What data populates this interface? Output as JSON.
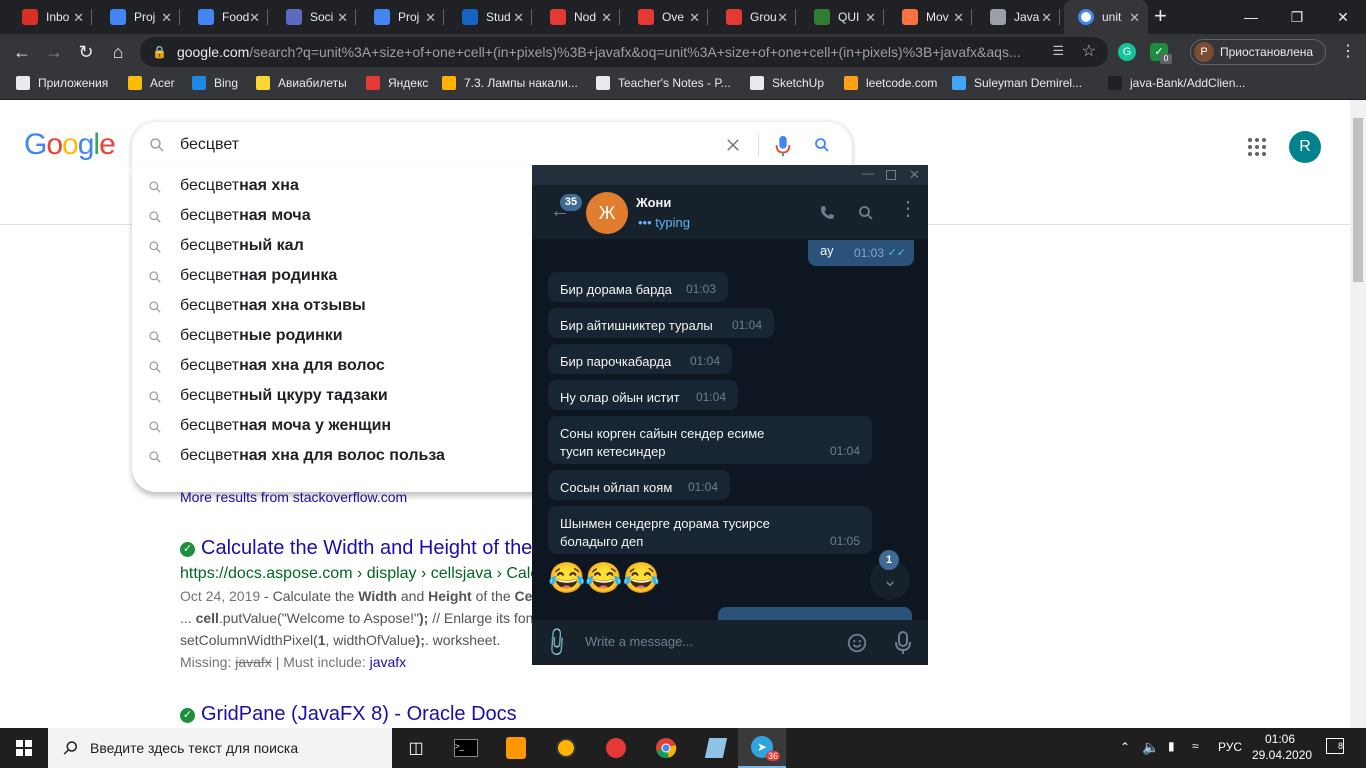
{
  "browser": {
    "tabs": [
      {
        "label": "Inbo",
        "color": "#d93025"
      },
      {
        "label": "Proj",
        "color": "#4285f4"
      },
      {
        "label": "Food",
        "color": "#4285f4"
      },
      {
        "label": "Soci",
        "color": "#5c6bc0"
      },
      {
        "label": "Proj",
        "color": "#4285f4"
      },
      {
        "label": "Stud",
        "color": "#1565c0"
      },
      {
        "label": "Nod",
        "color": "#e53935"
      },
      {
        "label": "Ove",
        "color": "#e53935"
      },
      {
        "label": "Grou",
        "color": "#e53935"
      },
      {
        "label": "QUI",
        "color": "#2e7d32"
      },
      {
        "label": "Mov",
        "color": "#ff7043"
      },
      {
        "label": "Java",
        "color": "#9aa0a6"
      },
      {
        "label": "unit",
        "color": "#ffffff"
      }
    ],
    "url_host": "google.com",
    "url_path": "/search?q=unit%3A+size+of+one+cell+(in+pixels)%3B+javafx&oq=unit%3A+size+of+one+cell+(in+pixels)%3B+javafx&aqs...",
    "profile_initial": "P",
    "profile_label": "Приостановлена",
    "grammarly_badge": "0",
    "bookmarks": [
      {
        "label": "Приложения",
        "icon": "apps-grid-icon"
      },
      {
        "label": "Acer",
        "icon": "folder-icon"
      },
      {
        "label": "Bing",
        "icon": "bing-icon"
      },
      {
        "label": "Авиабилеты",
        "icon": "plane-icon"
      },
      {
        "label": "Яндекс",
        "icon": "yandex-icon"
      },
      {
        "label": "7.3. Лампы накали...",
        "icon": "page-icon"
      },
      {
        "label": "Teacher's Notes - P...",
        "icon": "globe-icon"
      },
      {
        "label": "SketchUp",
        "icon": "globe-icon"
      },
      {
        "label": "leetcode.com",
        "icon": "leetcode-icon"
      },
      {
        "label": "Suleyman Demirel...",
        "icon": "sdu-icon"
      },
      {
        "label": "java-Bank/AddClien...",
        "icon": "github-icon"
      }
    ]
  },
  "google": {
    "query": "бесцвет",
    "suggestions": [
      {
        "prefix": "бесцвет",
        "rest": "ная хна"
      },
      {
        "prefix": "бесцвет",
        "rest": "ная моча"
      },
      {
        "prefix": "бесцвет",
        "rest": "ный кал"
      },
      {
        "prefix": "бесцвет",
        "rest": "ная родинка"
      },
      {
        "prefix": "бесцвет",
        "rest": "ная хна отзывы"
      },
      {
        "prefix": "бесцвет",
        "rest": "ные родинки"
      },
      {
        "prefix": "бесцвет",
        "rest": "ная хна для волос"
      },
      {
        "prefix": "бесцвет",
        "rest": "ный цкуру тадзаки"
      },
      {
        "prefix": "бесцвет",
        "rest": "ная моча у женщин"
      },
      {
        "prefix": "бесцвет",
        "rest": "ная хна для волос польза"
      }
    ],
    "avatar_letter": "R",
    "more_results": "More results from stackoverflow.com",
    "results": [
      {
        "title": "Calculate the Width and Height of the",
        "url": "https://docs.aspose.com › display › cellsjava › Calc",
        "date": "Oct 24, 2019",
        "snippet1": " - Calculate the ",
        "snippet1_b1": "Width",
        "snippet1_and": " and ",
        "snippet1_b2": "Height",
        "snippet1_of": " of the ",
        "snippet1_b3": "Ce",
        "snippet2_pre": "... ",
        "snippet2_b": "cell",
        "snippet2_rest": ".putValue(\"Welcome to Aspose!\"",
        "snippet2_b2": ");",
        "snippet2_tail": " // Enlarge its fon",
        "snippet3_pre": "setColumnWidthPixel(",
        "snippet3_b": "1",
        "snippet3_rest": ", widthOfValue",
        "snippet3_b2": ");",
        "snippet3_tail": ". worksheet.",
        "missing_label": "Missing: ",
        "missing_word": "javafx",
        "must_include": " | Must include: ",
        "must_word": "javafx"
      },
      {
        "title": "GridPane (JavaFX 8) - Oracle Docs"
      }
    ]
  },
  "telegram": {
    "unread_badge": "35",
    "contact_initial": "Ж",
    "contact_name": "Жони",
    "status": "typing",
    "avatar_color": "#e17d2f",
    "messages": [
      {
        "text": "ау",
        "time": "01:03",
        "out": true
      },
      {
        "text": "Бир дорама барда",
        "time": "01:03"
      },
      {
        "text": "Бир айтишниктер туралы",
        "time": "01:04"
      },
      {
        "text": "Бир парочкабарда",
        "time": "01:04"
      },
      {
        "text": "Ну олар ойын истит",
        "time": "01:04"
      },
      {
        "text": "Соны корген сайын сендер есиме тусип кетесиндер",
        "time": "01:04"
      },
      {
        "text": "Сосын ойлап коям",
        "time": "01:04"
      },
      {
        "text": "Шынмен сендерге дорама тусирсе боладыго деп",
        "time": "01:05"
      }
    ],
    "emoji": "😂😂😂",
    "scroll_badge": "1",
    "input_placeholder": "Write a message..."
  },
  "taskbar": {
    "search_placeholder": "Введите здесь текст для поиска",
    "lang": "РУС",
    "time": "01:06",
    "date": "29.04.2020",
    "telegram_badge": "36",
    "notif_badge": "8"
  }
}
